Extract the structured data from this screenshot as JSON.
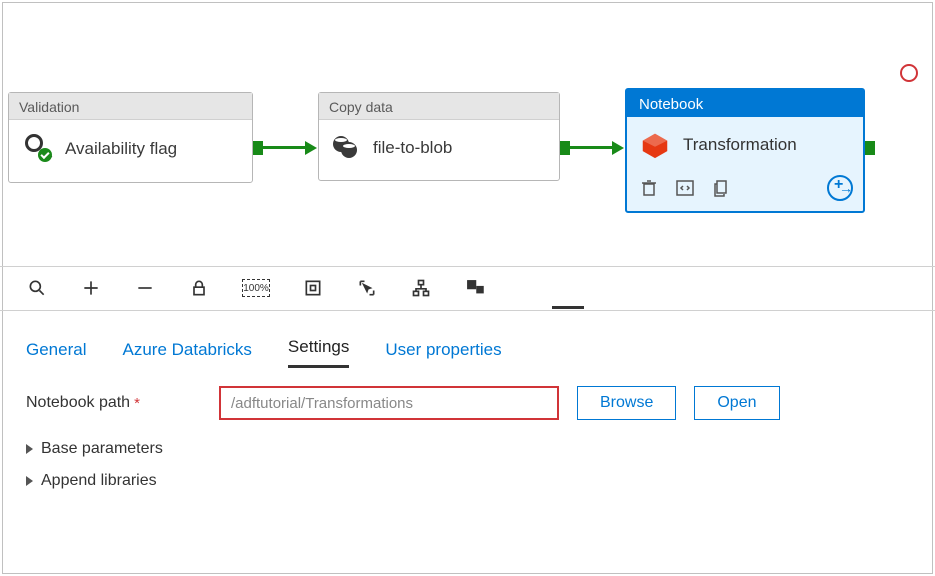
{
  "pipeline": {
    "activities": {
      "validation": {
        "type_label": "Validation",
        "name": "Availability flag"
      },
      "copy": {
        "type_label": "Copy data",
        "name": "file-to-blob"
      },
      "notebook": {
        "type_label": "Notebook",
        "name": "Transformation"
      }
    }
  },
  "mid_toolbar": {
    "tools": [
      "search",
      "add",
      "remove",
      "lock",
      "zoom-100",
      "fit",
      "select",
      "layout",
      "minimap"
    ]
  },
  "tabs": {
    "items": [
      "General",
      "Azure Databricks",
      "Settings",
      "User properties"
    ],
    "active_index": 2
  },
  "settings": {
    "notebook_path_label": "Notebook path",
    "notebook_path_value": "/adftutorial/Transformations",
    "browse_label": "Browse",
    "open_label": "Open",
    "expanders": {
      "base_parameters": "Base parameters",
      "append_libraries": "Append libraries"
    }
  }
}
